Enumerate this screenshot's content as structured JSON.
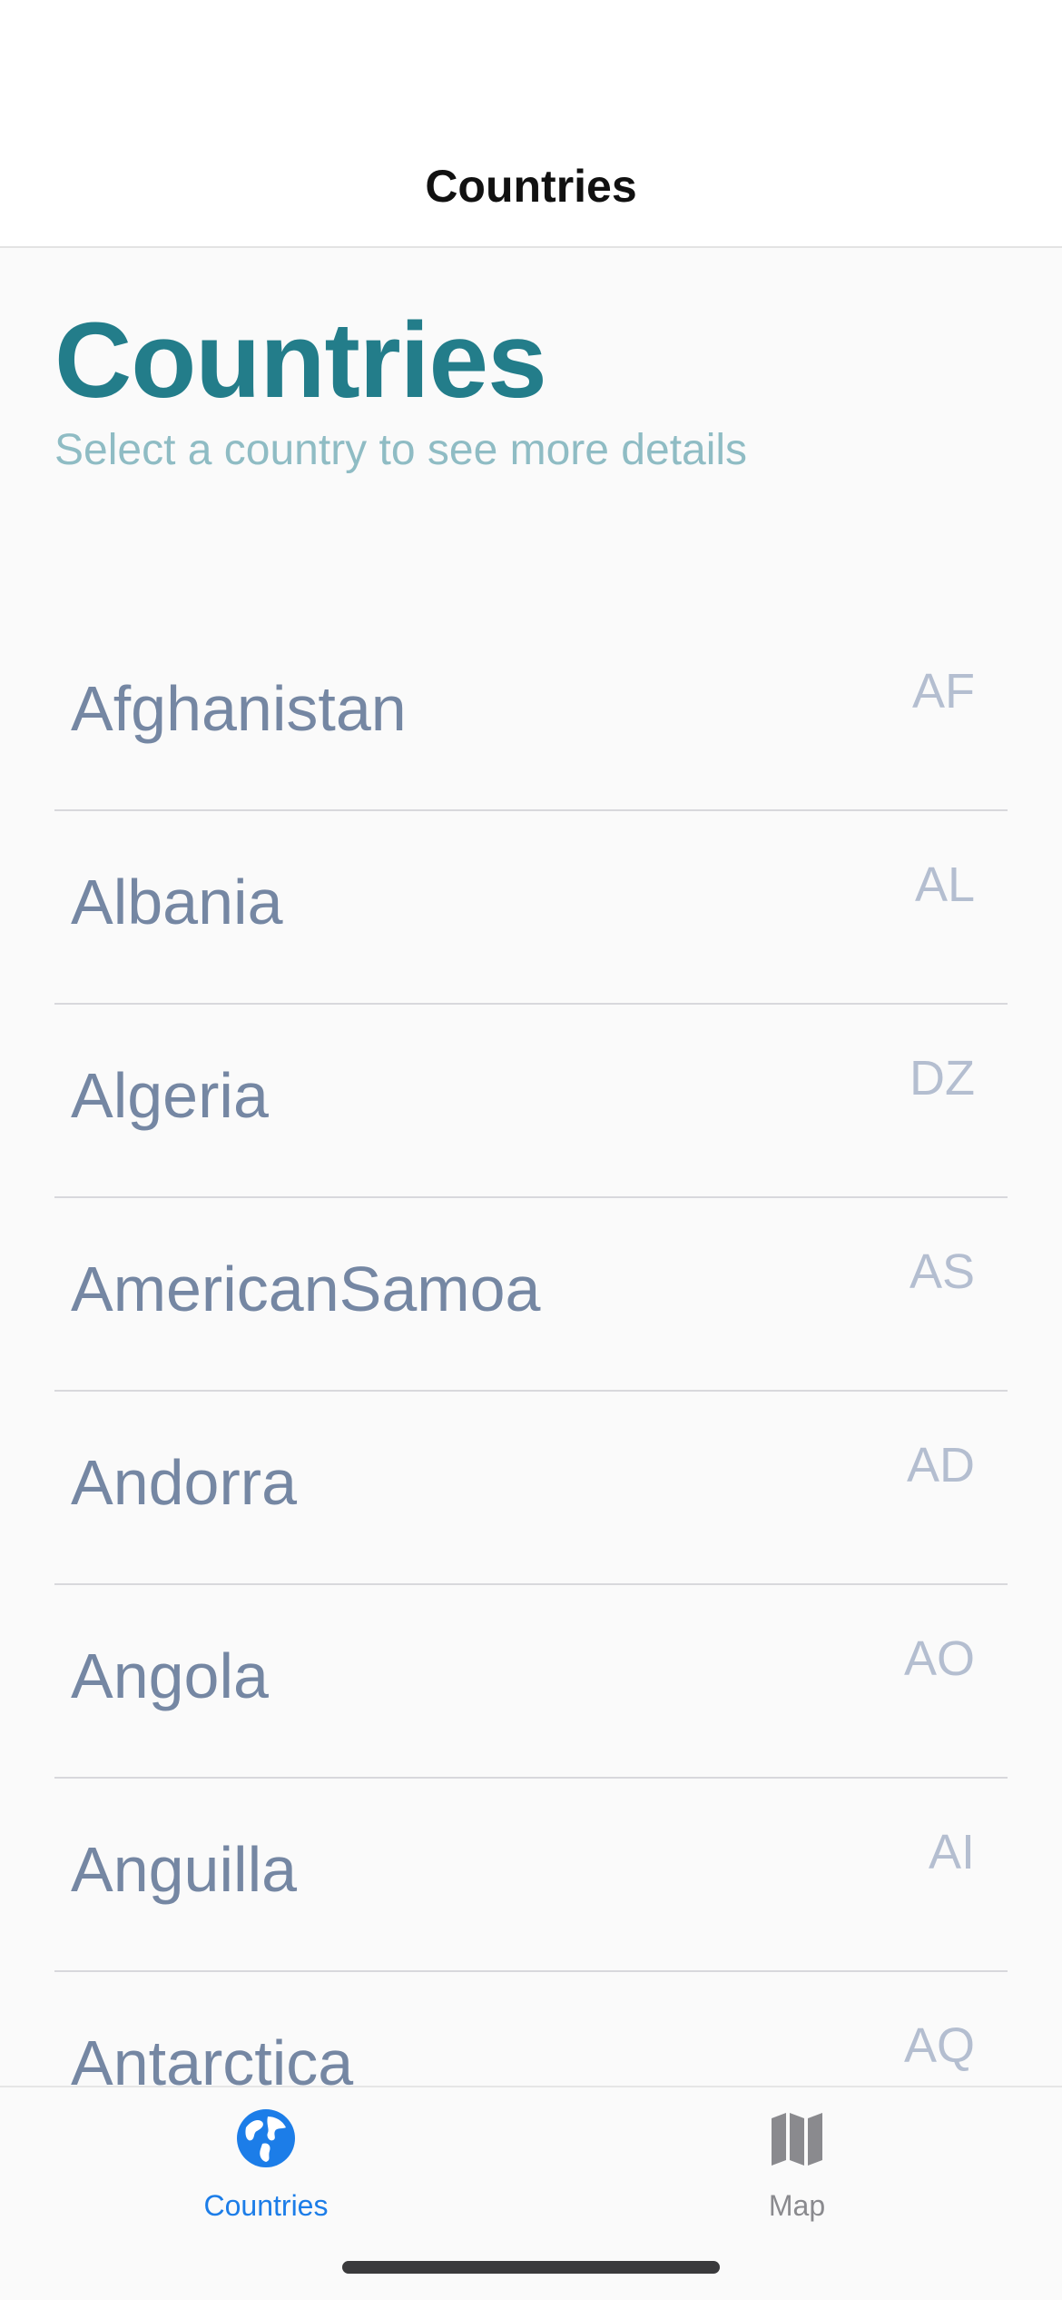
{
  "navbar": {
    "title": "Countries"
  },
  "header": {
    "title": "Countries",
    "subtitle": "Select a country to see more details"
  },
  "countries": [
    {
      "name": "Afghanistan",
      "code": "AF"
    },
    {
      "name": "Albania",
      "code": "AL"
    },
    {
      "name": "Algeria",
      "code": "DZ"
    },
    {
      "name": "AmericanSamoa",
      "code": "AS"
    },
    {
      "name": "Andorra",
      "code": "AD"
    },
    {
      "name": "Angola",
      "code": "AO"
    },
    {
      "name": "Anguilla",
      "code": "AI"
    },
    {
      "name": "Antarctica",
      "code": "AQ"
    }
  ],
  "tabbar": {
    "tabs": [
      {
        "label": "Countries",
        "icon": "globe-icon",
        "active": true
      },
      {
        "label": "Map",
        "icon": "map-icon",
        "active": false
      }
    ]
  },
  "colors": {
    "accent": "#1c7de8",
    "title": "#237d8a",
    "subtitle": "#8fbcc4",
    "country_name": "#7587a3",
    "country_code": "#b4bed0",
    "inactive_tab": "#8a8a8e"
  }
}
